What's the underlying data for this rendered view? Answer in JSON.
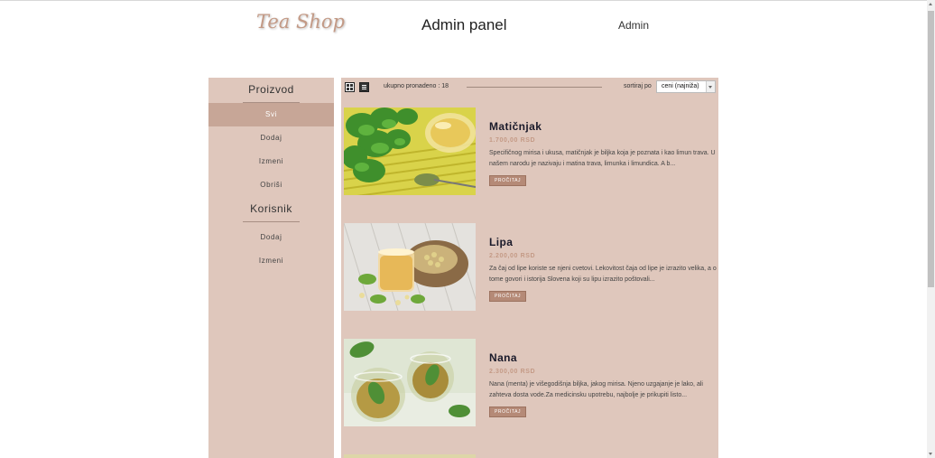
{
  "header": {
    "brand": "Tea Shop",
    "title": "Admin panel",
    "user_link": "Admin"
  },
  "sidebar": {
    "product_heading": "Proizvod",
    "product_items": [
      {
        "label": "Svi",
        "active": true
      },
      {
        "label": "Dodaj",
        "active": false
      },
      {
        "label": "Izmeni",
        "active": false
      },
      {
        "label": "Obriši",
        "active": false
      }
    ],
    "user_heading": "Korisnik",
    "user_items": [
      {
        "label": "Dodaj"
      },
      {
        "label": "Izmeni"
      }
    ]
  },
  "toolbar": {
    "grid_icon": "grid-view-icon",
    "list_icon": "list-view-icon",
    "total_text": "ukupno pronadeno : 18",
    "sort_label": "sortiraj po",
    "sort_value": "ceni (najniža)"
  },
  "products": [
    {
      "name": "Matičnjak",
      "price": "1.700,00 RSD",
      "description": "Specifičnog mirisa i ukusa, matičnjak je biljka koja je poznata i kao limun trava. U našem narodu je nazivaju i matina trava, limunka i limundica. A b...",
      "button": "PROČITAJ"
    },
    {
      "name": "Lipa",
      "price": "2.200,00 RSD",
      "description": "Za čaj od lipe koriste se njeni cvetovi. Lekovitost čaja od lipe je izrazito velika, a o tome govori i istorija Slovena koji su lipu izrazito poštovali...",
      "button": "PROČITAJ"
    },
    {
      "name": "Nana",
      "price": "2.300,00 RSD",
      "description": "Nana (menta) je višegodišnja biljka, jakog mirisa. Njeno uzgajanje je lako, ali zahteva dosta vode.Za medicinsku upotrebu, najbolje je prikupiti listo...",
      "button": "PROČITAJ"
    }
  ],
  "colors": {
    "panel_bg": "#dfc7bc",
    "active_item": "#c7a697",
    "brand": "#c39a86",
    "price": "#c49a86",
    "button": "#b58a77"
  }
}
